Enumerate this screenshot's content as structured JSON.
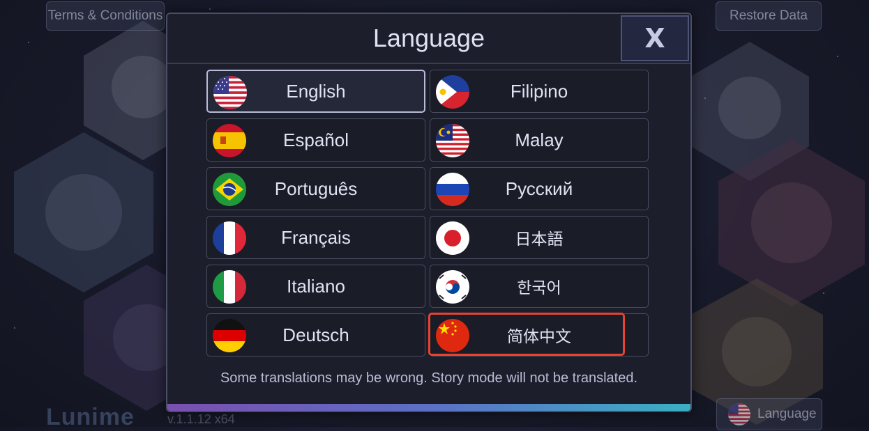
{
  "top": {
    "terms_label": "Terms & Conditions",
    "restore_label": "Restore Data",
    "language_label": "Language"
  },
  "brand": {
    "logo": "Lunime",
    "version": "v.1.1.12 x64"
  },
  "modal": {
    "title": "Language",
    "close_label": "X",
    "note": "Some translations may be wrong. Story mode will not be translated.",
    "languages": [
      {
        "label": "English",
        "flag": "us-flag-icon",
        "selected": true
      },
      {
        "label": "Filipino",
        "flag": "philippines-flag-icon"
      },
      {
        "label": "Español",
        "flag": "spain-flag-icon"
      },
      {
        "label": "Malay",
        "flag": "malaysia-flag-icon"
      },
      {
        "label": "Português",
        "flag": "brazil-flag-icon"
      },
      {
        "label": "Русский",
        "flag": "russia-flag-icon"
      },
      {
        "label": "Français",
        "flag": "france-flag-icon"
      },
      {
        "label": "日本語",
        "flag": "japan-flag-icon"
      },
      {
        "label": "Italiano",
        "flag": "italy-flag-icon"
      },
      {
        "label": "한국어",
        "flag": "korea-flag-icon"
      },
      {
        "label": "Deutsch",
        "flag": "germany-flag-icon"
      },
      {
        "label": "简体中文",
        "flag": "china-flag-icon",
        "highlighted": true
      }
    ]
  },
  "colors": {
    "highlight": "#e8432f",
    "panel": "#1c1e2c",
    "text": "#dfe2f2"
  }
}
